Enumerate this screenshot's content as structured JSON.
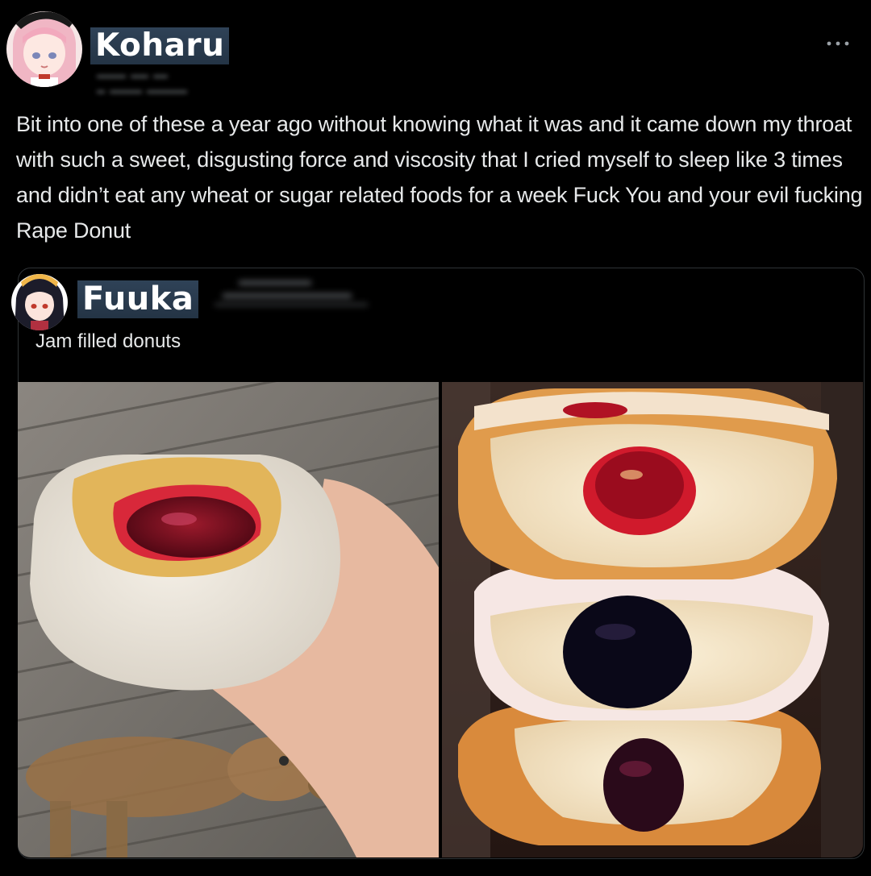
{
  "tweet": {
    "author_name": "Koharu",
    "more_icon": "more-horizontal-icon",
    "text": "Bit into one of these a year ago without knowing what it was and it came down my throat with such a sweet, disgusting force and viscosity that I cried myself to sleep like 3 times and didn’t eat any wheat or sugar related foods for a week Fuck You and your evil fucking Rape Donut"
  },
  "quote": {
    "author_name": "Fuuka",
    "text": "Jam filled donuts",
    "media": [
      {
        "name": "hand-holding-donut-photo"
      },
      {
        "name": "stacked-donuts-photo"
      }
    ]
  },
  "colors": {
    "background": "#000000",
    "text": "#e7e9ea",
    "border": "#2f3336",
    "name_highlight": "#2f4257"
  }
}
